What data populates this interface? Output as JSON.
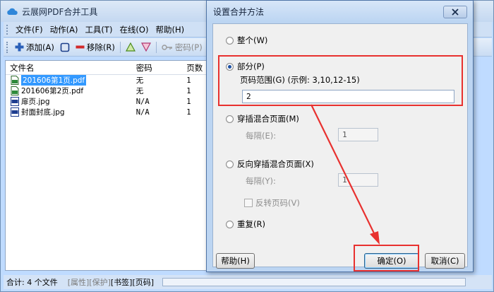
{
  "app": {
    "title": "云展网PDF合并工具",
    "menu": [
      "文件(F)",
      "动作(A)",
      "工具(T)",
      "在线(O)",
      "帮助(H)"
    ],
    "toolbar": {
      "add_label": "添加(A)",
      "remove_label": "移除(R)",
      "password_label": "密码(P)"
    },
    "list": {
      "headers": [
        "文件名",
        "密码",
        "页数"
      ],
      "rows": [
        {
          "name": "201606第1页.pdf",
          "password": "无",
          "pages": "1",
          "icon": "pdf-file-icon"
        },
        {
          "name": "201606第2页.pdf",
          "password": "无",
          "pages": "1",
          "icon": "pdf-file-icon"
        },
        {
          "name": "扉页.jpg",
          "password": "N/A",
          "pages": "1",
          "icon": "jpg-file-icon"
        },
        {
          "name": "封面封底.jpg",
          "password": "N/A",
          "pages": "1",
          "icon": "jpg-file-icon"
        }
      ]
    },
    "status": {
      "total": "合计: 4 个文件",
      "attr": "[属性]",
      "protect": "[保护]",
      "bookmark": "[书签]",
      "pagecode": "[页码]"
    }
  },
  "dialog": {
    "title": "设置合并方法",
    "options": {
      "whole": "整个(W)",
      "part": "部分(P)",
      "page_range_label": "页码范围(G) (示例: 3,10,12-15)",
      "page_range_value": "2",
      "interleave": "穿插混合页面(M)",
      "interval_label_1": "每隔(E):",
      "interval_value_1": "1",
      "reverse_interleave": "反向穿插混合页面(X)",
      "interval_label_2": "每隔(Y):",
      "interval_value_2": "1",
      "reverse_pagecode": "反转页码(V)",
      "repeat": "重复(R)"
    },
    "buttons": {
      "help": "帮助(H)",
      "ok": "确定(O)",
      "cancel": "取消(C)"
    }
  },
  "colors": {
    "accent": "#3399ff",
    "annotation_red": "#e8312f"
  }
}
